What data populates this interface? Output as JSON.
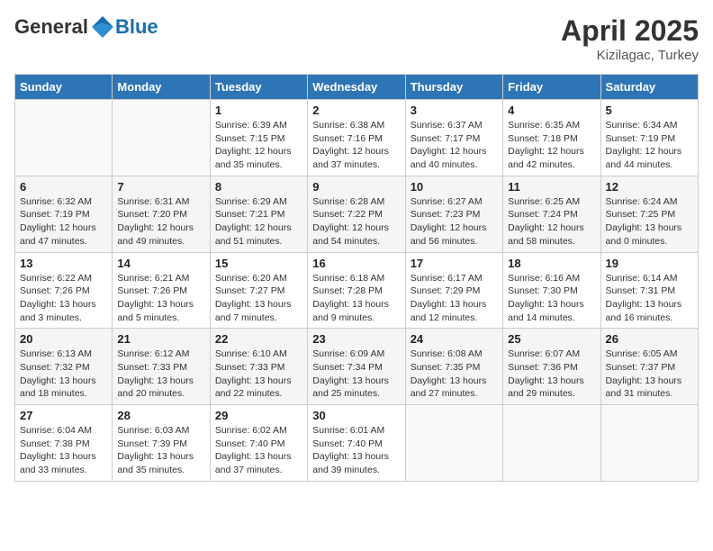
{
  "header": {
    "logo_general": "General",
    "logo_blue": "Blue",
    "title": "April 2025",
    "subtitle": "Kizilagac, Turkey"
  },
  "days_of_week": [
    "Sunday",
    "Monday",
    "Tuesday",
    "Wednesday",
    "Thursday",
    "Friday",
    "Saturday"
  ],
  "weeks": [
    [
      {
        "day": "",
        "sunrise": "",
        "sunset": "",
        "daylight": ""
      },
      {
        "day": "",
        "sunrise": "",
        "sunset": "",
        "daylight": ""
      },
      {
        "day": "1",
        "sunrise": "Sunrise: 6:39 AM",
        "sunset": "Sunset: 7:15 PM",
        "daylight": "Daylight: 12 hours and 35 minutes."
      },
      {
        "day": "2",
        "sunrise": "Sunrise: 6:38 AM",
        "sunset": "Sunset: 7:16 PM",
        "daylight": "Daylight: 12 hours and 37 minutes."
      },
      {
        "day": "3",
        "sunrise": "Sunrise: 6:37 AM",
        "sunset": "Sunset: 7:17 PM",
        "daylight": "Daylight: 12 hours and 40 minutes."
      },
      {
        "day": "4",
        "sunrise": "Sunrise: 6:35 AM",
        "sunset": "Sunset: 7:18 PM",
        "daylight": "Daylight: 12 hours and 42 minutes."
      },
      {
        "day": "5",
        "sunrise": "Sunrise: 6:34 AM",
        "sunset": "Sunset: 7:19 PM",
        "daylight": "Daylight: 12 hours and 44 minutes."
      }
    ],
    [
      {
        "day": "6",
        "sunrise": "Sunrise: 6:32 AM",
        "sunset": "Sunset: 7:19 PM",
        "daylight": "Daylight: 12 hours and 47 minutes."
      },
      {
        "day": "7",
        "sunrise": "Sunrise: 6:31 AM",
        "sunset": "Sunset: 7:20 PM",
        "daylight": "Daylight: 12 hours and 49 minutes."
      },
      {
        "day": "8",
        "sunrise": "Sunrise: 6:29 AM",
        "sunset": "Sunset: 7:21 PM",
        "daylight": "Daylight: 12 hours and 51 minutes."
      },
      {
        "day": "9",
        "sunrise": "Sunrise: 6:28 AM",
        "sunset": "Sunset: 7:22 PM",
        "daylight": "Daylight: 12 hours and 54 minutes."
      },
      {
        "day": "10",
        "sunrise": "Sunrise: 6:27 AM",
        "sunset": "Sunset: 7:23 PM",
        "daylight": "Daylight: 12 hours and 56 minutes."
      },
      {
        "day": "11",
        "sunrise": "Sunrise: 6:25 AM",
        "sunset": "Sunset: 7:24 PM",
        "daylight": "Daylight: 12 hours and 58 minutes."
      },
      {
        "day": "12",
        "sunrise": "Sunrise: 6:24 AM",
        "sunset": "Sunset: 7:25 PM",
        "daylight": "Daylight: 13 hours and 0 minutes."
      }
    ],
    [
      {
        "day": "13",
        "sunrise": "Sunrise: 6:22 AM",
        "sunset": "Sunset: 7:26 PM",
        "daylight": "Daylight: 13 hours and 3 minutes."
      },
      {
        "day": "14",
        "sunrise": "Sunrise: 6:21 AM",
        "sunset": "Sunset: 7:26 PM",
        "daylight": "Daylight: 13 hours and 5 minutes."
      },
      {
        "day": "15",
        "sunrise": "Sunrise: 6:20 AM",
        "sunset": "Sunset: 7:27 PM",
        "daylight": "Daylight: 13 hours and 7 minutes."
      },
      {
        "day": "16",
        "sunrise": "Sunrise: 6:18 AM",
        "sunset": "Sunset: 7:28 PM",
        "daylight": "Daylight: 13 hours and 9 minutes."
      },
      {
        "day": "17",
        "sunrise": "Sunrise: 6:17 AM",
        "sunset": "Sunset: 7:29 PM",
        "daylight": "Daylight: 13 hours and 12 minutes."
      },
      {
        "day": "18",
        "sunrise": "Sunrise: 6:16 AM",
        "sunset": "Sunset: 7:30 PM",
        "daylight": "Daylight: 13 hours and 14 minutes."
      },
      {
        "day": "19",
        "sunrise": "Sunrise: 6:14 AM",
        "sunset": "Sunset: 7:31 PM",
        "daylight": "Daylight: 13 hours and 16 minutes."
      }
    ],
    [
      {
        "day": "20",
        "sunrise": "Sunrise: 6:13 AM",
        "sunset": "Sunset: 7:32 PM",
        "daylight": "Daylight: 13 hours and 18 minutes."
      },
      {
        "day": "21",
        "sunrise": "Sunrise: 6:12 AM",
        "sunset": "Sunset: 7:33 PM",
        "daylight": "Daylight: 13 hours and 20 minutes."
      },
      {
        "day": "22",
        "sunrise": "Sunrise: 6:10 AM",
        "sunset": "Sunset: 7:33 PM",
        "daylight": "Daylight: 13 hours and 22 minutes."
      },
      {
        "day": "23",
        "sunrise": "Sunrise: 6:09 AM",
        "sunset": "Sunset: 7:34 PM",
        "daylight": "Daylight: 13 hours and 25 minutes."
      },
      {
        "day": "24",
        "sunrise": "Sunrise: 6:08 AM",
        "sunset": "Sunset: 7:35 PM",
        "daylight": "Daylight: 13 hours and 27 minutes."
      },
      {
        "day": "25",
        "sunrise": "Sunrise: 6:07 AM",
        "sunset": "Sunset: 7:36 PM",
        "daylight": "Daylight: 13 hours and 29 minutes."
      },
      {
        "day": "26",
        "sunrise": "Sunrise: 6:05 AM",
        "sunset": "Sunset: 7:37 PM",
        "daylight": "Daylight: 13 hours and 31 minutes."
      }
    ],
    [
      {
        "day": "27",
        "sunrise": "Sunrise: 6:04 AM",
        "sunset": "Sunset: 7:38 PM",
        "daylight": "Daylight: 13 hours and 33 minutes."
      },
      {
        "day": "28",
        "sunrise": "Sunrise: 6:03 AM",
        "sunset": "Sunset: 7:39 PM",
        "daylight": "Daylight: 13 hours and 35 minutes."
      },
      {
        "day": "29",
        "sunrise": "Sunrise: 6:02 AM",
        "sunset": "Sunset: 7:40 PM",
        "daylight": "Daylight: 13 hours and 37 minutes."
      },
      {
        "day": "30",
        "sunrise": "Sunrise: 6:01 AM",
        "sunset": "Sunset: 7:40 PM",
        "daylight": "Daylight: 13 hours and 39 minutes."
      },
      {
        "day": "",
        "sunrise": "",
        "sunset": "",
        "daylight": ""
      },
      {
        "day": "",
        "sunrise": "",
        "sunset": "",
        "daylight": ""
      },
      {
        "day": "",
        "sunrise": "",
        "sunset": "",
        "daylight": ""
      }
    ]
  ]
}
